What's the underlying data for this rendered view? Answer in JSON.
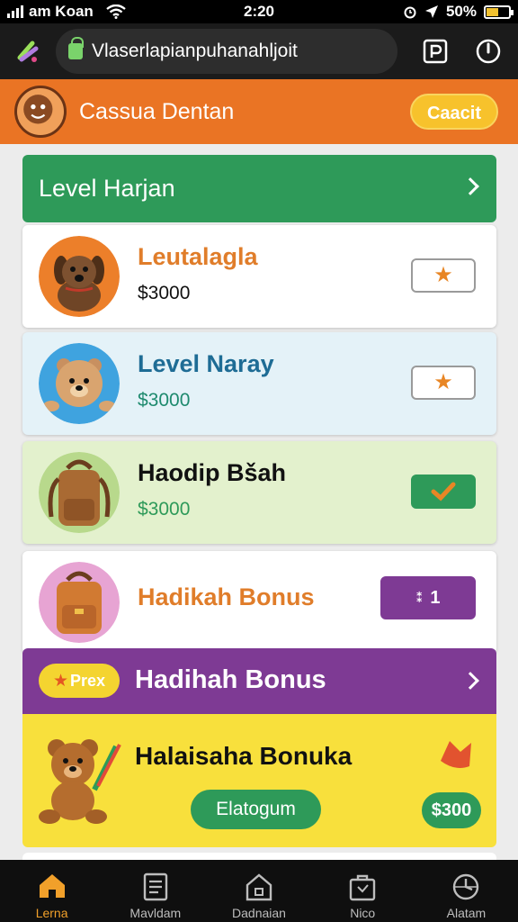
{
  "status_bar": {
    "carrier": "am Koan",
    "time": "2:20",
    "battery": "50%",
    "battery_level": 0.5
  },
  "browser": {
    "url": "Vlaserlapianpuhanahljoit"
  },
  "app": {
    "title": "Cassua Dentan",
    "button_label": "Caacit"
  },
  "level_header": {
    "label": "Level Harjan"
  },
  "items": [
    {
      "title": "Leutalagla",
      "price": "$3000",
      "action": "star-icon",
      "title_color": "#e07d2a",
      "price_color": "#111111"
    },
    {
      "title": "Level Naray",
      "price": "$3000",
      "action": "star-icon",
      "title_color": "#1e6c95",
      "price_color": "#1e8a6e"
    },
    {
      "title": "Haodip Bšah",
      "price": "$3000",
      "action": "check-icon",
      "title_color": "#111111",
      "price_color": "#2e9a59"
    },
    {
      "title": "Hadikah Bonus",
      "action_text": "1",
      "title_color": "#e07d2a"
    }
  ],
  "bonus": {
    "badge": "Prex",
    "header": "Hadihah Bonus",
    "title": "Halaisaha Bonuka",
    "button": "Elatogum",
    "price": "$300"
  },
  "nav": [
    {
      "label": "Lerna",
      "icon": "home-icon",
      "active": true
    },
    {
      "label": "Mavldam",
      "icon": "document-icon",
      "active": false
    },
    {
      "label": "Dadnaian",
      "icon": "building-icon",
      "active": false
    },
    {
      "label": "Nico",
      "icon": "bag-icon",
      "active": false
    },
    {
      "label": "Alatam",
      "icon": "clock-icon",
      "active": false
    }
  ],
  "colors": {
    "accent_orange": "#ea7424",
    "green": "#2e9a59",
    "purple": "#7e3a94",
    "yellow": "#f8e03c",
    "nav_active": "#f1a02a"
  }
}
